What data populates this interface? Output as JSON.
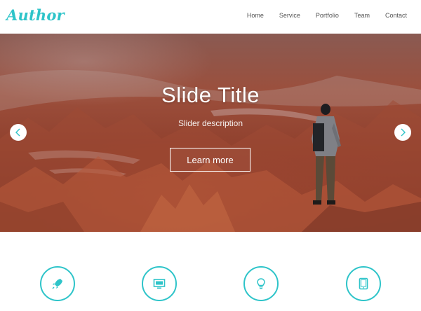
{
  "header": {
    "logo": "Author",
    "nav": [
      "Home",
      "Service",
      "Portfolio",
      "Team",
      "Contact"
    ]
  },
  "hero": {
    "title": "Slide Title",
    "description": "Slider description",
    "button_label": "Learn more"
  },
  "features": {
    "icons": [
      "rocket-icon",
      "monitor-icon",
      "lightbulb-icon",
      "tablet-icon"
    ]
  },
  "colors": {
    "accent": "#2ec4c9",
    "nav_text": "#555555",
    "hero_base": "#8f3f2c"
  }
}
